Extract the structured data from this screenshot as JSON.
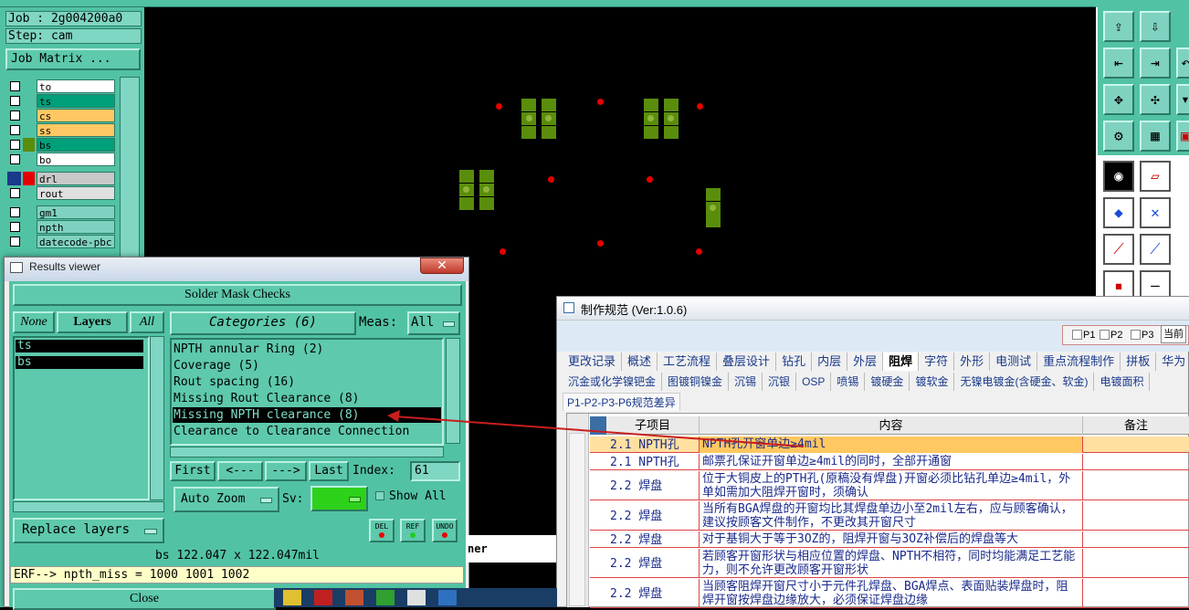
{
  "left_panel": {
    "job": "Job : 2g004200a0",
    "step": "Step: cam",
    "job_matrix": "Job Matrix ...",
    "layers": [
      {
        "name": "to",
        "color": "#ffffff"
      },
      {
        "name": "ts",
        "color": "#00a07a"
      },
      {
        "name": "cs",
        "color": "#ffc864"
      },
      {
        "name": "ss",
        "color": "#ffc864"
      },
      {
        "name": "bs",
        "color": "#00a07a"
      },
      {
        "name": "bo",
        "color": "#ffffff"
      },
      {
        "name": "drl",
        "color": "#c8c8c8"
      },
      {
        "name": "rout",
        "color": "#e0e0e0"
      },
      {
        "name": "gm1",
        "color": "#7fd2c0"
      },
      {
        "name": "npth",
        "color": "#7fd2c0"
      },
      {
        "name": "datecode-pbc",
        "color": "#7fd2c0"
      }
    ]
  },
  "results_viewer": {
    "title": "Results viewer",
    "header": "Solder Mask Checks",
    "none_btn": "None",
    "layers_btn": "Layers",
    "all_btn": "All",
    "layer_list": [
      "ts",
      "bs"
    ],
    "categories_btn": "Categories (6)",
    "meas_label": "Meas:",
    "meas_value": "All",
    "categories": [
      "NPTH annular Ring (2)",
      "Coverage (5)",
      "Rout spacing (16)",
      "Missing Rout Clearance (8)",
      "Missing NPTH clearance (8)",
      "Clearance to Clearance Connection"
    ],
    "first_btn": "First",
    "prev_btn": "<---",
    "next_btn": "--->",
    "last_btn": "Last",
    "index_label": "Index:",
    "index_value": "61",
    "auto_zoom": "Auto Zoom",
    "sv_label": "Sv:",
    "show_all": "Show All",
    "replace_layers": "Replace layers",
    "del_btn": "DEL",
    "ref_btn": "REF",
    "undo_btn": "UNDO",
    "size_text": "bs 122.047 x 122.047mil",
    "erf_text": "ERF--> npth_miss = 1000 1001 1002",
    "close_btn": "Close"
  },
  "spec_window": {
    "title": "制作规范 (Ver:1.0.6)",
    "pages": [
      "P1",
      "P2",
      "P3",
      "当前"
    ],
    "tabs1": [
      "更改记录",
      "概述",
      "工艺流程",
      "叠层设计",
      "钻孔",
      "内层",
      "外层",
      "阻焊",
      "字符",
      "外形",
      "电测试",
      "重点流程制作",
      "拼板",
      "华为"
    ],
    "active_tab": "阻焊",
    "tabs2": [
      "沉金或化学镍钯金",
      "图镀铜镍金",
      "沉锡",
      "沉银",
      "OSP",
      "喷锡",
      "镀硬金",
      "镀软金",
      "无镍电镀金(含硬金、软金)",
      "电镀面积"
    ],
    "subtab": "P1-P2-P3-P6规范差异",
    "columns": [
      "子项目",
      "内容",
      "备注"
    ],
    "rows": [
      {
        "item": "2.1 NPTH孔",
        "content": "NPTH孔开窗单边≥4mil",
        "highlight": true
      },
      {
        "item": "2.1 NPTH孔",
        "content": "邮票孔保证开窗单边≥4mil的同时，全部开通窗"
      },
      {
        "item": "2.2 焊盘",
        "content": "位于大铜皮上的PTH孔(原稿没有焊盘)开窗必须比钻孔单边≥4mil，外单如需加大阻焊开窗时，须确认"
      },
      {
        "item": "2.2 焊盘",
        "content": "当所有BGA焊盘的开窗均比其焊盘单边小至2mil左右，应与顾客确认，建议按顾客文件制作，不更改其开窗尺寸"
      },
      {
        "item": "2.2 焊盘",
        "content": "对于基铜大于等于3OZ的，阻焊开窗与3OZ补偿后的焊盘等大"
      },
      {
        "item": "2.2 焊盘",
        "content": "若顾客开窗形状与相应位置的焊盘、NPTH不相符，同时均能满足工艺能力，则不允许更改顾客开窗形状"
      },
      {
        "item": "2.2 焊盘",
        "content": "当顾客阻焊开窗尺寸小于元件孔焊盘、BGA焊点、表面贴装焊盘时，阻焊开窗按焊盘边缘放大，必须保证焊盘边缘"
      }
    ]
  },
  "misc": {
    "partial_label": "ner"
  }
}
